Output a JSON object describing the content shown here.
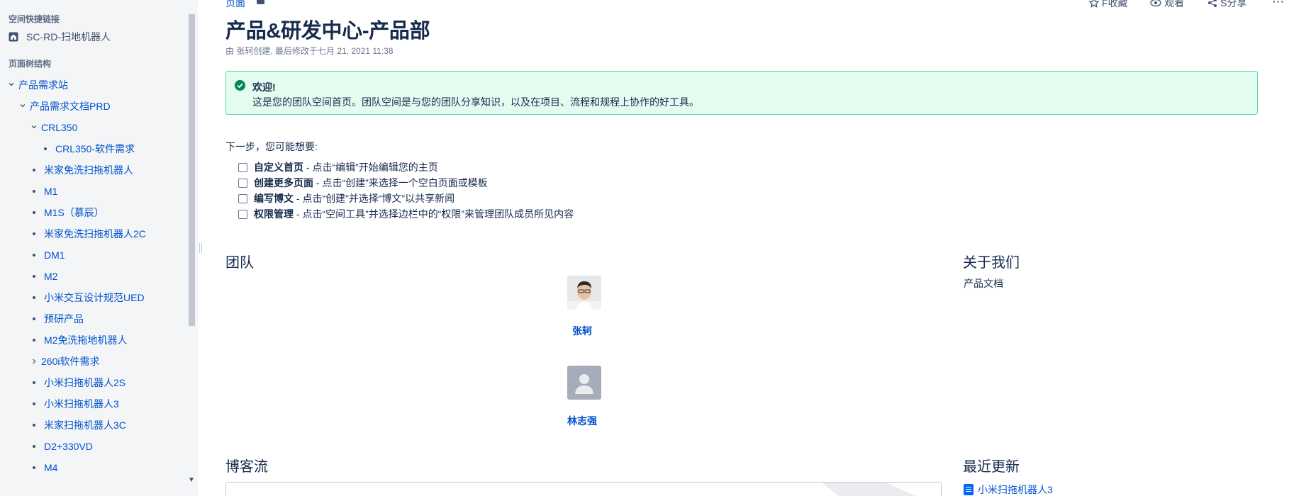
{
  "sidebar": {
    "quick_links_heading": "空间快捷链接",
    "quick_link_label": "SC-RD-扫地机器人",
    "tree_heading": "页面树结构",
    "tree": [
      {
        "label": "产品需求站",
        "marker": "chevron-down"
      },
      {
        "label": "产品需求文档PRD",
        "marker": "chevron-down"
      },
      {
        "label": "CRL350",
        "marker": "chevron-down"
      },
      {
        "label": "CRL350-软件需求",
        "marker": "bullet"
      },
      {
        "label": "米家免洗扫拖机器人",
        "marker": "bullet"
      },
      {
        "label": "M1",
        "marker": "bullet"
      },
      {
        "label": "M1S（慕辰）",
        "marker": "bullet"
      },
      {
        "label": "米家免洗扫拖机器人2C",
        "marker": "bullet"
      },
      {
        "label": "DM1",
        "marker": "bullet"
      },
      {
        "label": "M2",
        "marker": "bullet"
      },
      {
        "label": "小米交互设计规范UED",
        "marker": "bullet"
      },
      {
        "label": "预研产品",
        "marker": "bullet"
      },
      {
        "label": "M2免洗拖地机器人",
        "marker": "bullet"
      },
      {
        "label": "260i软件需求",
        "marker": "chevron-right"
      },
      {
        "label": "小米扫拖机器人2S",
        "marker": "bullet"
      },
      {
        "label": "小米扫拖机器人3",
        "marker": "bullet"
      },
      {
        "label": "米家扫拖机器人3C",
        "marker": "bullet"
      },
      {
        "label": "D2+330VD",
        "marker": "bullet"
      },
      {
        "label": "M4",
        "marker": "bullet"
      }
    ]
  },
  "header": {
    "breadcrumb": "页面",
    "actions": {
      "favorite": "F收藏",
      "watch": "观看",
      "share": "S分享"
    }
  },
  "page": {
    "title": "产品&研发中心-产品部",
    "byline": "由 张轲创建, 最后修改于七月 21, 2021 11:38"
  },
  "welcome": {
    "title": "欢迎!",
    "text": "这是您的团队空间首页。团队空间是与您的团队分享知识，以及在项目、流程和规程上协作的好工具。"
  },
  "next_steps": {
    "heading": "下一步，您可能想要:",
    "tasks": [
      {
        "bold": "自定义首页",
        "rest": " - 点击“编辑”开始编辑您的主页"
      },
      {
        "bold": "创建更多页面",
        "rest": " - 点击“创建”来选择一个空白页面或模板"
      },
      {
        "bold": "编写博文",
        "rest": " - 点击“创建”并选择“博文”以共享新闻"
      },
      {
        "bold": "权限管理",
        "rest": " - 点击“空间工具”并选择边栏中的“权限”来管理团队成员所见内容"
      }
    ]
  },
  "team": {
    "title": "团队",
    "members": [
      {
        "name": "张轲",
        "avatar": "photo"
      },
      {
        "name": "林志强",
        "avatar": "default-user-icon"
      }
    ]
  },
  "about": {
    "title": "关于我们",
    "text": "产品文档"
  },
  "blog": {
    "title": "博客流"
  },
  "recent": {
    "title": "最近更新",
    "items": [
      "小米扫拖机器人3"
    ]
  },
  "colors": {
    "link": "#0052cc",
    "text": "#172b4d",
    "sidebar_bg": "#f4f5f7",
    "success_bg": "#e3fcef",
    "success_border": "#57d9a3",
    "success_icon": "#00875a"
  }
}
